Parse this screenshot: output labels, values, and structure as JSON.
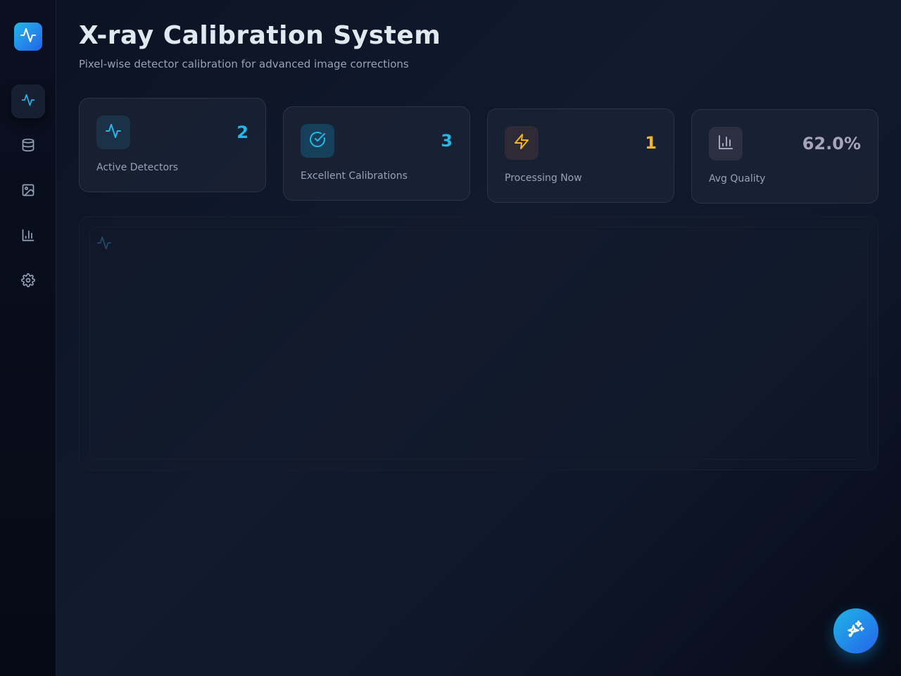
{
  "header": {
    "title": "X-ray Calibration System",
    "subtitle": "Pixel-wise detector calibration for advanced image corrections"
  },
  "sidebar": {
    "logo_icon": "activity-icon",
    "items": [
      {
        "icon": "activity-icon",
        "active": true
      },
      {
        "icon": "database-icon",
        "active": false
      },
      {
        "icon": "image-icon",
        "active": false
      },
      {
        "icon": "bar-chart-icon",
        "active": false
      },
      {
        "icon": "settings-icon",
        "active": false
      }
    ]
  },
  "stats": [
    {
      "label": "Active Detectors",
      "value": "2",
      "icon": "activity-icon",
      "color": "#22b8e8"
    },
    {
      "label": "Excellent Calibrations",
      "value": "3",
      "icon": "check-circle-icon",
      "color": "#22b8e8"
    },
    {
      "label": "Processing Now",
      "value": "1",
      "icon": "zap-icon",
      "color": "#f5b521"
    },
    {
      "label": "Avg Quality",
      "value": "62.0%",
      "icon": "bar-chart-icon",
      "color": "#a7a3bd"
    }
  ],
  "panel": {
    "icon": "activity-icon"
  },
  "fab": {
    "icon": "sparkles-icon"
  },
  "colors": {
    "accent": "#22b8e8",
    "warning": "#f5b521",
    "muted": "#94a3b8",
    "background": "#0b1120"
  }
}
